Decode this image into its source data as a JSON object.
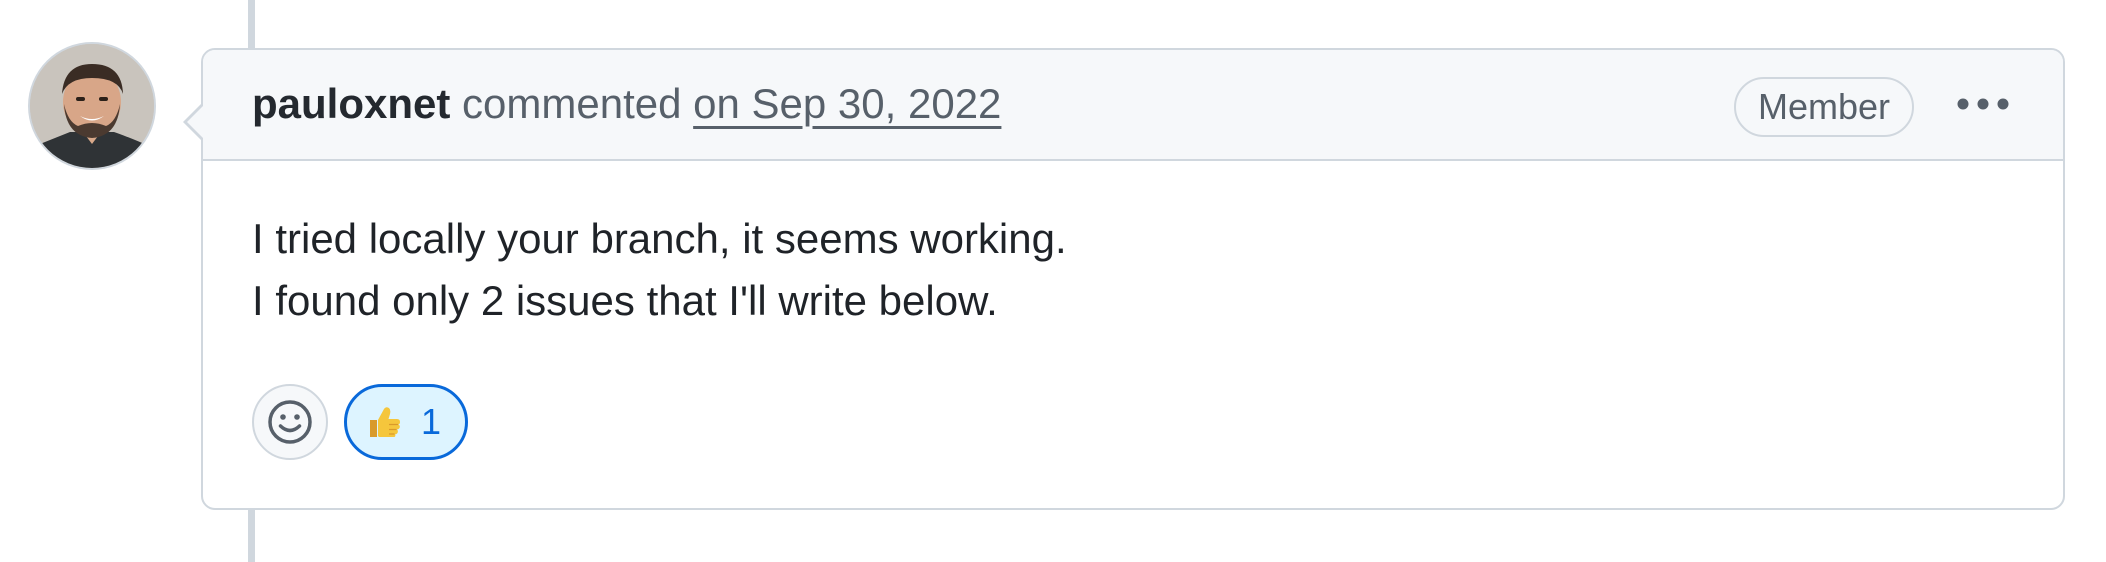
{
  "comment": {
    "author": "pauloxnet",
    "action": "commented",
    "timestamp": "on Sep 30, 2022",
    "role_badge": "Member",
    "body": [
      "I tried locally your branch, it seems working.",
      "I found only 2 issues that I'll write below."
    ],
    "reactions": [
      {
        "emoji": "thumbs-up-emoji",
        "count": "1",
        "selected": true
      }
    ]
  },
  "icons": {
    "more": "kebab-horizontal-icon",
    "add_reaction": "smiley-icon"
  },
  "colors": {
    "header_bg": "#f6f8fa",
    "border": "#d0d7de",
    "reaction_selected_border": "#0969da",
    "reaction_selected_bg": "#ddf4ff",
    "text_primary": "#1f2328",
    "text_muted": "#57606a"
  }
}
